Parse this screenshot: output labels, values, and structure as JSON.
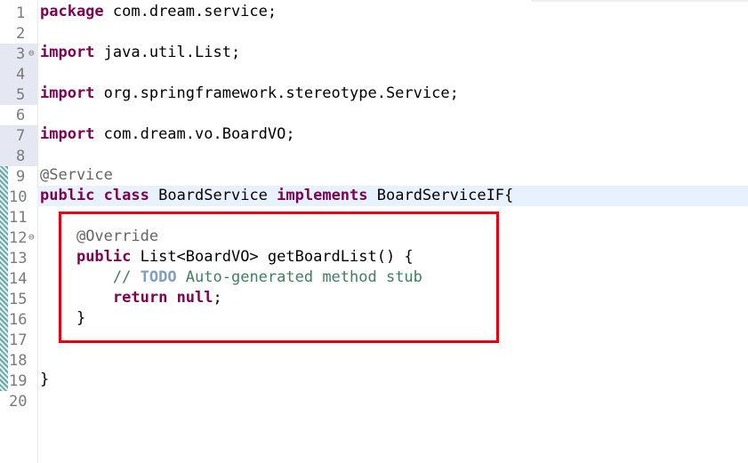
{
  "editor": {
    "lines": [
      {
        "num": "1",
        "code": [
          {
            "t": "package",
            "k": "kw"
          },
          {
            "t": " com.dream.service;"
          }
        ]
      },
      {
        "num": "2",
        "code": []
      },
      {
        "num": "3",
        "fold": "⊖",
        "code": [
          {
            "t": "import",
            "k": "kw"
          },
          {
            "t": " java.util.List;"
          }
        ]
      },
      {
        "num": "4",
        "code": []
      },
      {
        "num": "5",
        "code": [
          {
            "t": "import",
            "k": "kw"
          },
          {
            "t": " org.springframework.stereotype.Service;"
          }
        ]
      },
      {
        "num": "6",
        "code": []
      },
      {
        "num": "7",
        "code": [
          {
            "t": "import",
            "k": "kw"
          },
          {
            "t": " com.dream.vo.BoardVO;"
          }
        ]
      },
      {
        "num": "8",
        "code": []
      },
      {
        "num": "9",
        "code": [
          {
            "t": "@Service",
            "k": "ann"
          }
        ]
      },
      {
        "num": "10",
        "code": [
          {
            "t": "public",
            "k": "kw"
          },
          {
            "t": " "
          },
          {
            "t": "class",
            "k": "kw"
          },
          {
            "t": " BoardService "
          },
          {
            "t": "implements",
            "k": "kw"
          },
          {
            "t": " BoardServiceIF{"
          }
        ]
      },
      {
        "num": "11",
        "code": []
      },
      {
        "num": "12",
        "fold": "⊖",
        "code": [
          {
            "t": "    "
          },
          {
            "t": "@Override",
            "k": "ann"
          }
        ]
      },
      {
        "num": "13",
        "code": [
          {
            "t": "    "
          },
          {
            "t": "public",
            "k": "kw"
          },
          {
            "t": " List<BoardVO> getBoardList() {"
          }
        ]
      },
      {
        "num": "14",
        "code": [
          {
            "t": "        "
          },
          {
            "t": "// ",
            "k": "comment"
          },
          {
            "t": "TODO",
            "k": "todo"
          },
          {
            "t": " Auto-generated method stub",
            "k": "comment"
          }
        ]
      },
      {
        "num": "15",
        "code": [
          {
            "t": "        "
          },
          {
            "t": "return",
            "k": "kw"
          },
          {
            "t": " "
          },
          {
            "t": "null",
            "k": "kw"
          },
          {
            "t": ";"
          }
        ]
      },
      {
        "num": "16",
        "code": [
          {
            "t": "    }"
          }
        ]
      },
      {
        "num": "17",
        "code": []
      },
      {
        "num": "18",
        "code": []
      },
      {
        "num": "19",
        "code": [
          {
            "t": "}"
          }
        ]
      },
      {
        "num": "20",
        "code": []
      }
    ],
    "colors": {
      "keyword": "#7f0055",
      "annotation": "#646464",
      "comment": "#3f7f5f",
      "todo": "#7f9fbf",
      "highlight_box": "#e60012",
      "current_line": "#e8f2fe"
    }
  }
}
